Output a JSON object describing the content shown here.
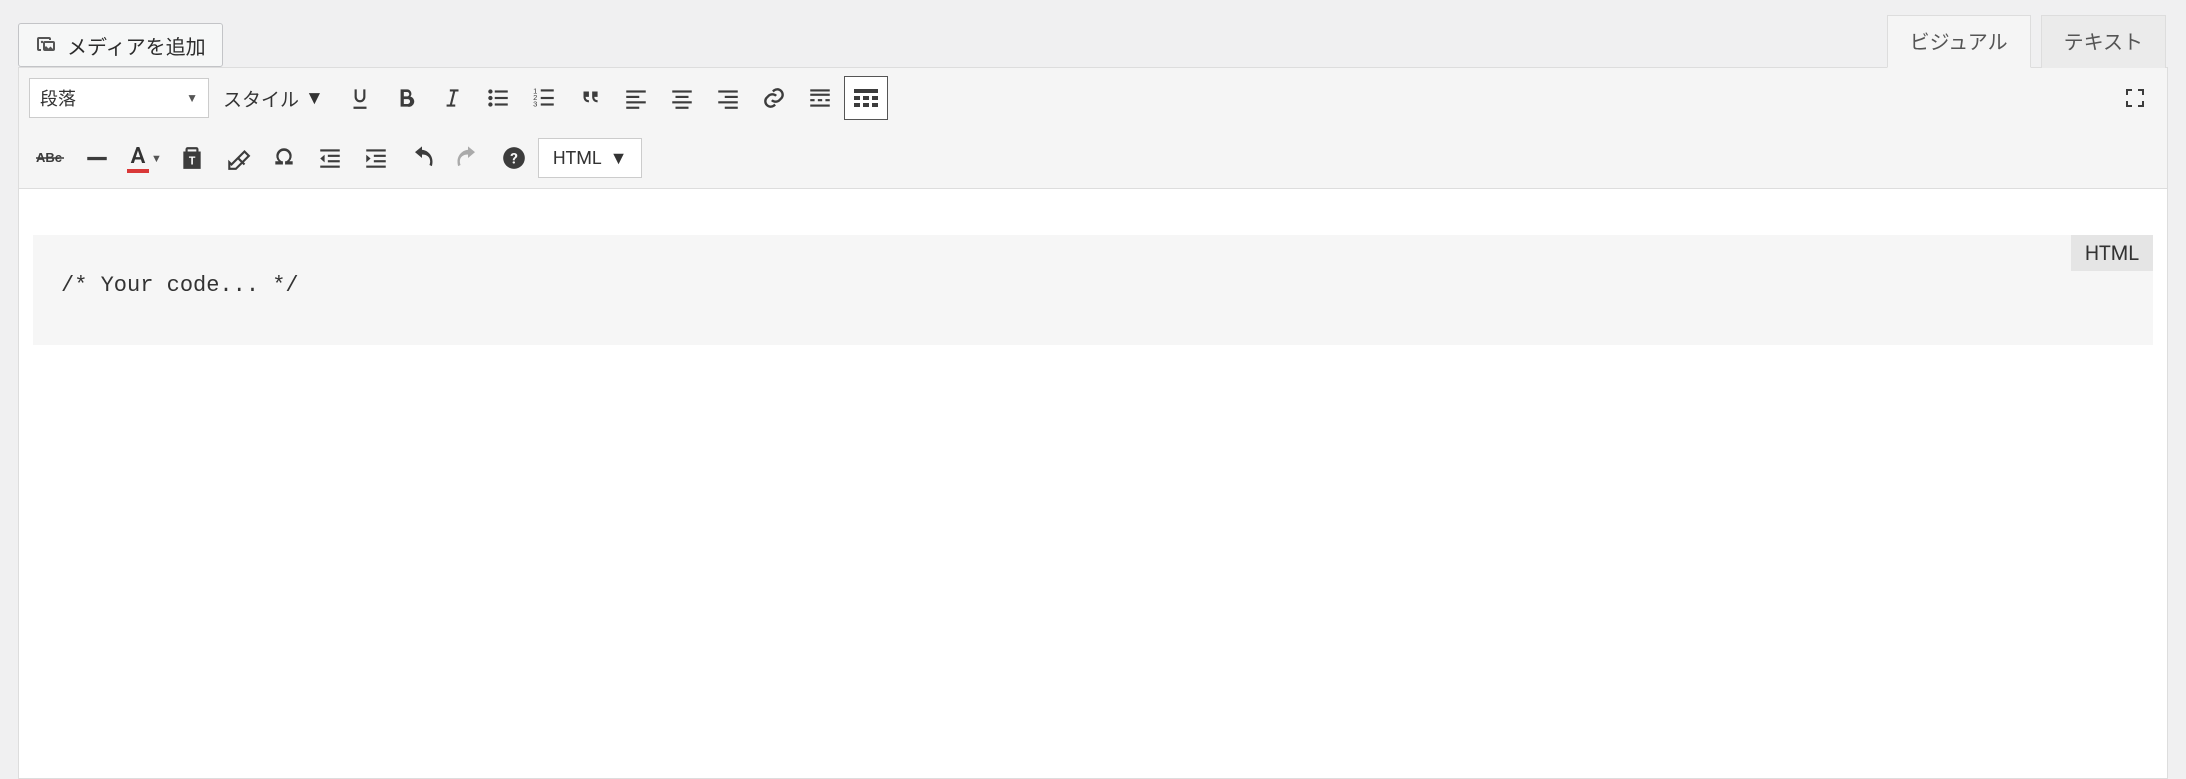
{
  "mediaButton": {
    "label": "メディアを追加"
  },
  "tabs": {
    "visual": "ビジュアル",
    "text": "テキスト"
  },
  "toolbar": {
    "paragraphLabel": "段落",
    "styleLabel": "スタイル",
    "htmlLabel": "HTML"
  },
  "codeBlock": {
    "badge": "HTML",
    "content": "/* Your code... */"
  }
}
